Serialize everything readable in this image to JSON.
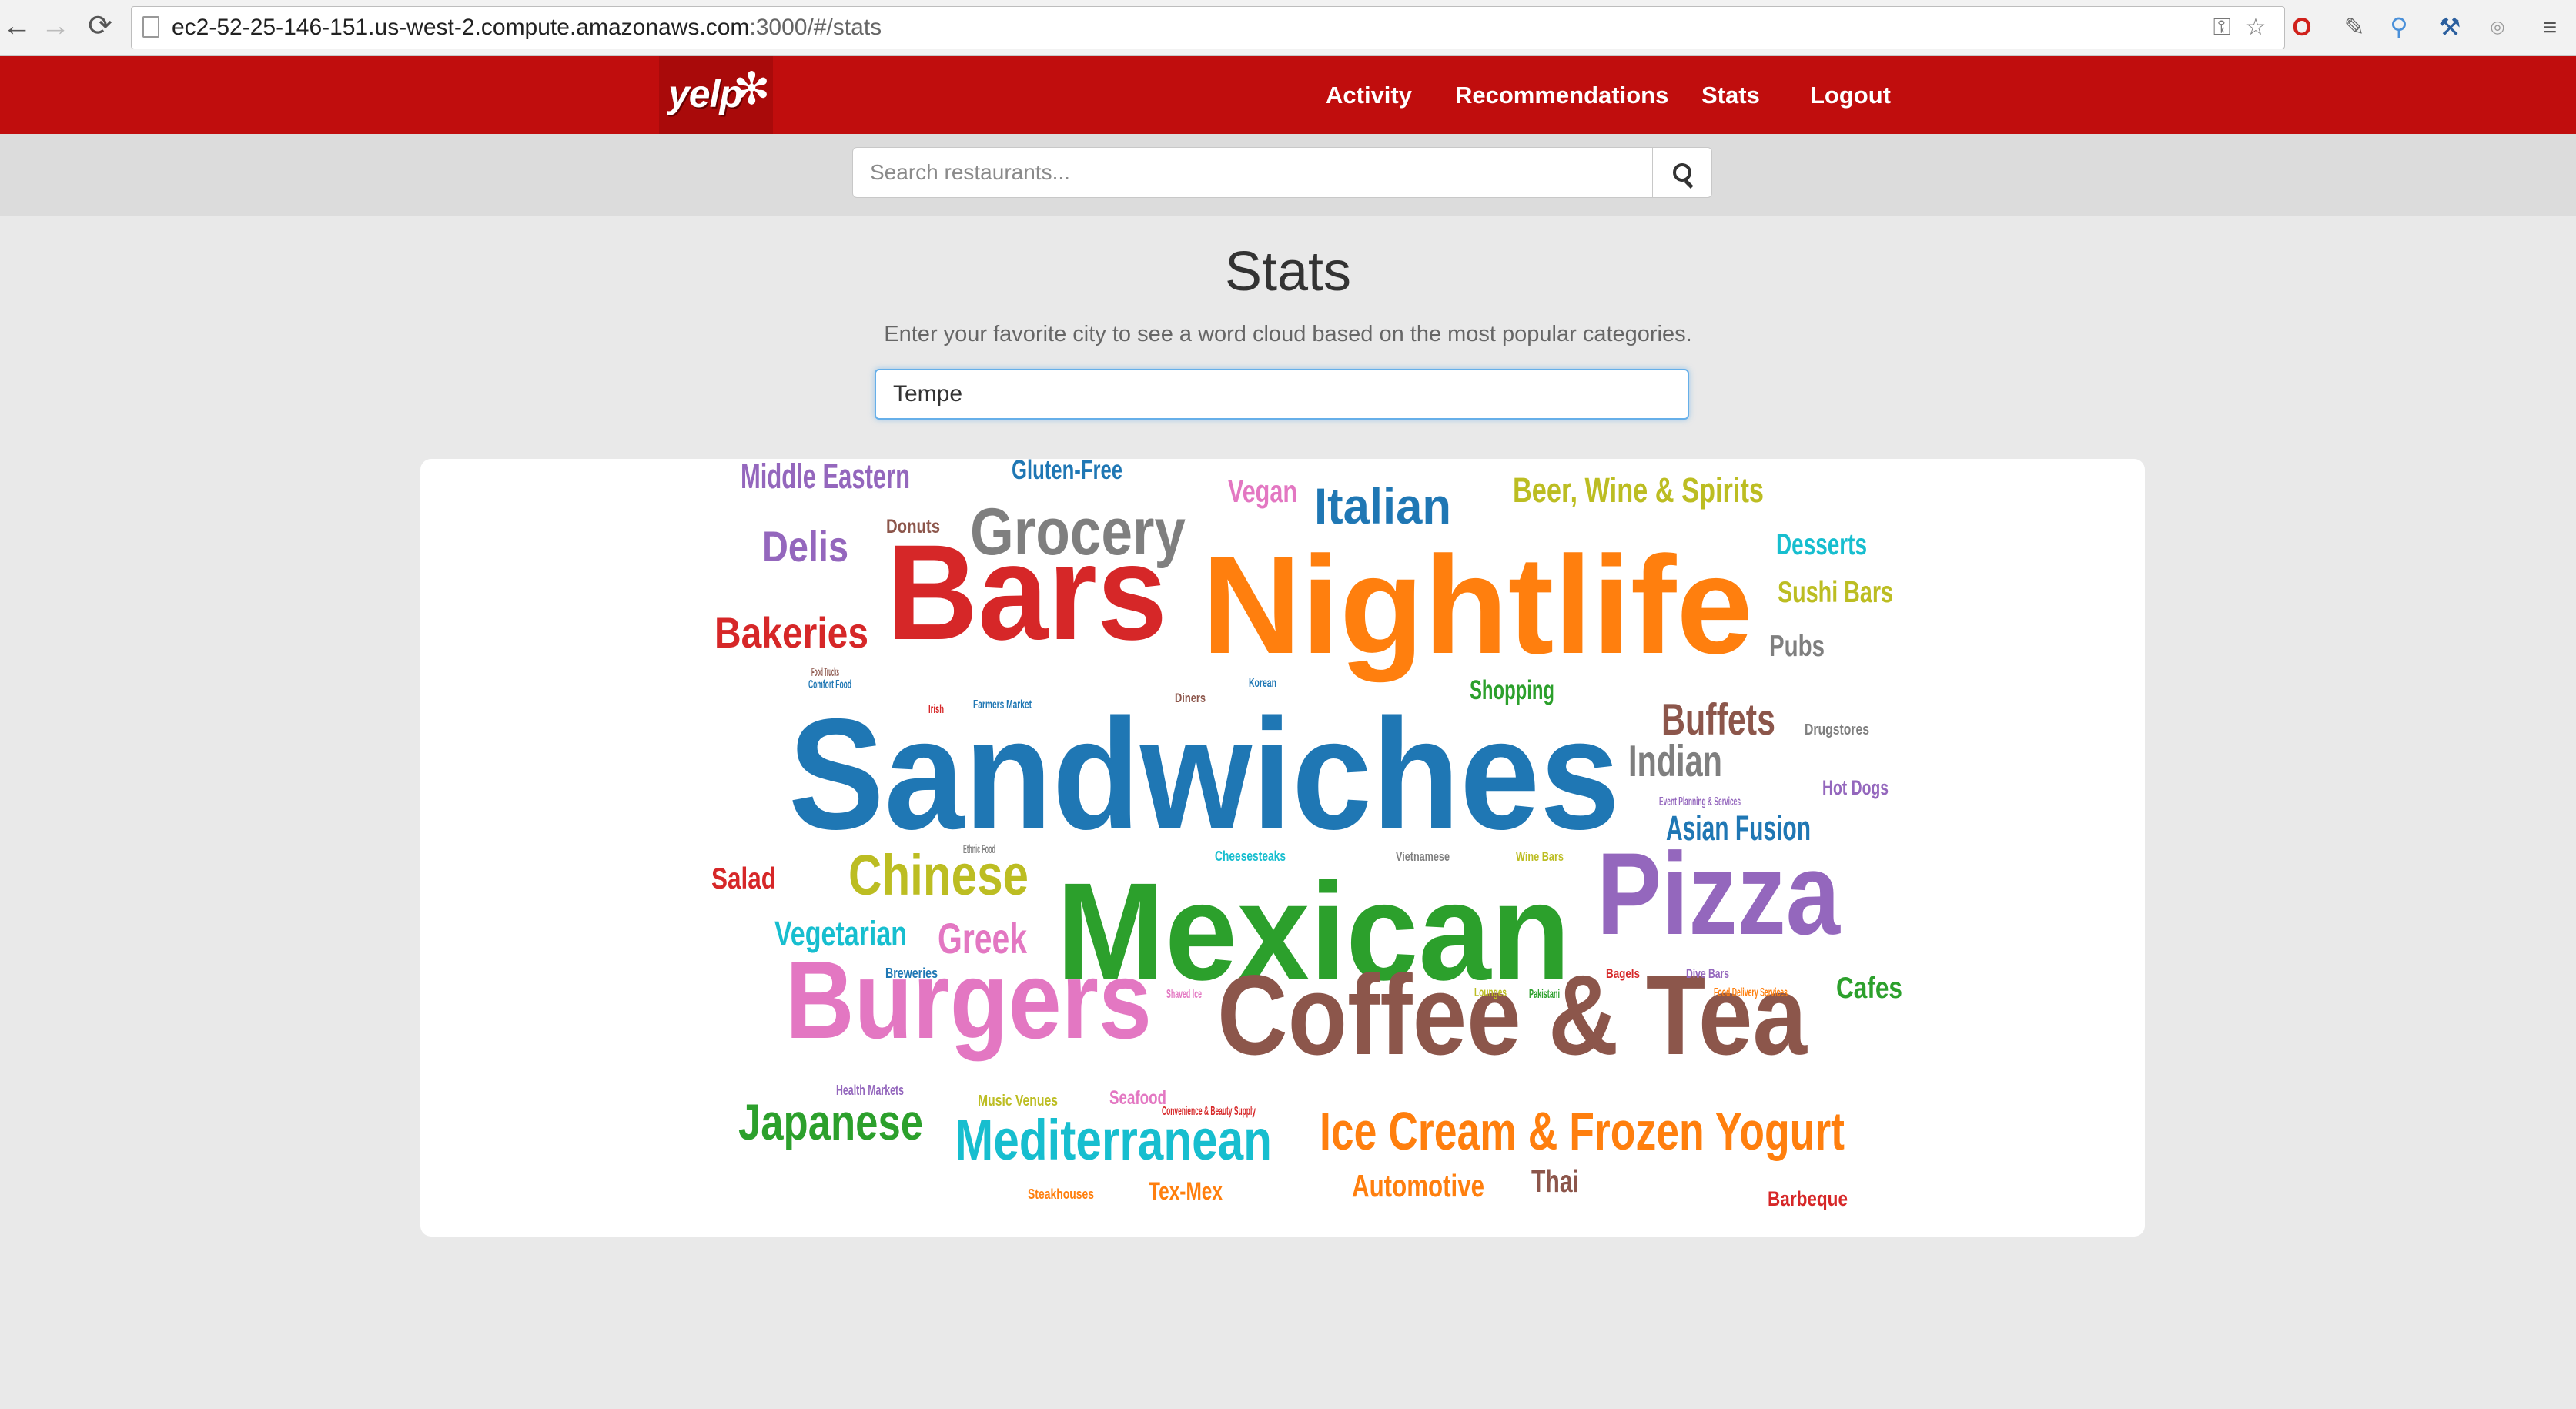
{
  "browser": {
    "url_main": "ec2-52-25-146-151.us-west-2.compute.amazonaws.com",
    "url_rest": ":3000/#/stats"
  },
  "navbar": {
    "logo": "yelp",
    "links": [
      "Activity",
      "Recommendations",
      "Stats",
      "Logout"
    ]
  },
  "search": {
    "placeholder": "Search restaurants..."
  },
  "stats": {
    "title": "Stats",
    "subtitle": "Enter your favorite city to see a word cloud based on the most popular categories.",
    "city_value": "Tempe"
  },
  "palette": {
    "red": "#d62728",
    "orange": "#ff7f0e",
    "blue": "#1f77b4",
    "green": "#2ca02c",
    "purple": "#9467bd",
    "brown": "#8c564b",
    "pink": "#e377c2",
    "gray": "#7f7f7f",
    "olive": "#bcbd22",
    "cyan": "#17becf"
  },
  "chart_data": {
    "type": "wordcloud",
    "words": [
      {
        "text": "Sandwiches",
        "weight": 100,
        "color": "blue"
      },
      {
        "text": "Nightlife",
        "weight": 88,
        "color": "orange"
      },
      {
        "text": "Mexican",
        "weight": 88,
        "color": "green"
      },
      {
        "text": "Bars",
        "weight": 86,
        "color": "red"
      },
      {
        "text": "Pizza",
        "weight": 74,
        "color": "purple"
      },
      {
        "text": "Coffee & Tea",
        "weight": 72,
        "color": "brown"
      },
      {
        "text": "Burgers",
        "weight": 70,
        "color": "pink"
      },
      {
        "text": "Grocery",
        "weight": 42,
        "color": "gray"
      },
      {
        "text": "Chinese",
        "weight": 36,
        "color": "olive"
      },
      {
        "text": "Mediterranean",
        "weight": 36,
        "color": "cyan"
      },
      {
        "text": "Ice Cream & Frozen Yogurt",
        "weight": 34,
        "color": "orange"
      },
      {
        "text": "Japanese",
        "weight": 32,
        "color": "green"
      },
      {
        "text": "Italian",
        "weight": 32,
        "color": "blue"
      },
      {
        "text": "Buffets",
        "weight": 28,
        "color": "brown"
      },
      {
        "text": "Indian",
        "weight": 28,
        "color": "gray"
      },
      {
        "text": "Bakeries",
        "weight": 27,
        "color": "red"
      },
      {
        "text": "Delis",
        "weight": 27,
        "color": "purple"
      },
      {
        "text": "Greek",
        "weight": 27,
        "color": "pink"
      },
      {
        "text": "Middle Eastern",
        "weight": 22,
        "color": "purple"
      },
      {
        "text": "Beer, Wine & Spirits",
        "weight": 22,
        "color": "olive"
      },
      {
        "text": "Vegetarian",
        "weight": 22,
        "color": "cyan"
      },
      {
        "text": "Asian Fusion",
        "weight": 22,
        "color": "blue"
      },
      {
        "text": "Automotive",
        "weight": 20,
        "color": "orange"
      },
      {
        "text": "Thai",
        "weight": 20,
        "color": "brown"
      },
      {
        "text": "Vegan",
        "weight": 20,
        "color": "pink"
      },
      {
        "text": "Desserts",
        "weight": 19,
        "color": "cyan"
      },
      {
        "text": "Sushi Bars",
        "weight": 19,
        "color": "olive"
      },
      {
        "text": "Pubs",
        "weight": 19,
        "color": "gray"
      },
      {
        "text": "Cafes",
        "weight": 19,
        "color": "green"
      },
      {
        "text": "Salad",
        "weight": 19,
        "color": "red"
      },
      {
        "text": "Gluten-Free",
        "weight": 17,
        "color": "blue"
      },
      {
        "text": "Shopping",
        "weight": 17,
        "color": "green"
      },
      {
        "text": "Tex-Mex",
        "weight": 16,
        "color": "orange"
      },
      {
        "text": "Hot Dogs",
        "weight": 13,
        "color": "purple"
      },
      {
        "text": "Barbeque",
        "weight": 13,
        "color": "red"
      },
      {
        "text": "Donuts",
        "weight": 12,
        "color": "brown"
      },
      {
        "text": "Seafood",
        "weight": 12,
        "color": "pink"
      },
      {
        "text": "Music Venues",
        "weight": 10,
        "color": "olive"
      },
      {
        "text": "Drugstores",
        "weight": 10,
        "color": "gray"
      },
      {
        "text": "Steakhouses",
        "weight": 9,
        "color": "orange"
      },
      {
        "text": "Health Markets",
        "weight": 9,
        "color": "purple"
      },
      {
        "text": "Cheesesteaks",
        "weight": 9,
        "color": "cyan"
      },
      {
        "text": "Breweries",
        "weight": 9,
        "color": "blue"
      },
      {
        "text": "Vietnamese",
        "weight": 8,
        "color": "gray"
      },
      {
        "text": "Wine Bars",
        "weight": 8,
        "color": "olive"
      },
      {
        "text": "Dive Bars",
        "weight": 8,
        "color": "purple"
      },
      {
        "text": "Bagels",
        "weight": 8,
        "color": "red"
      },
      {
        "text": "Diners",
        "weight": 8,
        "color": "brown"
      },
      {
        "text": "Korean",
        "weight": 7,
        "color": "blue"
      },
      {
        "text": "Farmers Market",
        "weight": 7,
        "color": "blue"
      },
      {
        "text": "Event Planning & Services",
        "weight": 6,
        "color": "purple"
      },
      {
        "text": "Food Delivery Services",
        "weight": 6,
        "color": "orange"
      },
      {
        "text": "Shaved Ice",
        "weight": 6,
        "color": "pink"
      },
      {
        "text": "Lounges",
        "weight": 6,
        "color": "olive"
      },
      {
        "text": "Pakistani",
        "weight": 6,
        "color": "green"
      },
      {
        "text": "Comfort Food",
        "weight": 5,
        "color": "blue"
      },
      {
        "text": "Ethnic Food",
        "weight": 5,
        "color": "gray"
      },
      {
        "text": "Irish",
        "weight": 5,
        "color": "red"
      },
      {
        "text": "Food Trucks",
        "weight": 4,
        "color": "brown"
      },
      {
        "text": "Convenience & Beauty Supply",
        "weight": 4,
        "color": "red"
      }
    ]
  }
}
